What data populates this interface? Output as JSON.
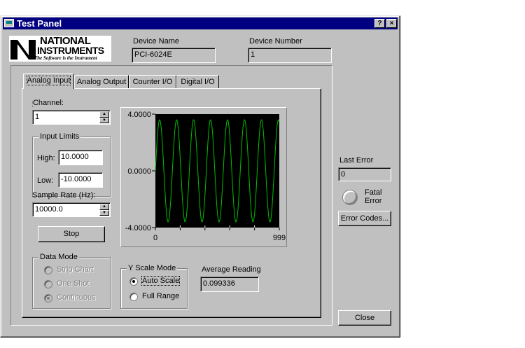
{
  "window": {
    "title": "Test Panel",
    "help_btn": "?",
    "close_btn": "×"
  },
  "logo": {
    "line1": "NATIONAL",
    "line2": "INSTRUMENTS",
    "tagline": "The Software is the Instrument"
  },
  "device": {
    "name_label": "Device Name",
    "name_value": "PCI-6024E",
    "number_label": "Device Number",
    "number_value": "1"
  },
  "tabs": [
    "Analog Input",
    "Analog Output",
    "Counter I/O",
    "Digital I/O"
  ],
  "analog_input": {
    "channel_label": "Channel:",
    "channel_value": "1",
    "input_limits_label": "Input Limits",
    "high_label": "High:",
    "high_value": "10.0000",
    "low_label": "Low:",
    "low_value": "-10.0000",
    "sample_rate_label": "Sample Rate (Hz):",
    "sample_rate_value": "10000.0",
    "stop_label": "Stop",
    "data_mode_label": "Data Mode",
    "data_modes": [
      "Strip Chart",
      "One Shot",
      "Continuous"
    ],
    "data_mode_selected": 2,
    "y_scale_label": "Y Scale Mode",
    "y_scale_modes": [
      "Auto Scale",
      "Full Range"
    ],
    "y_scale_selected": 0,
    "avg_label": "Average Reading",
    "avg_value": "0.099336"
  },
  "graph": {
    "y_ticks": [
      "4.0000",
      "0.0000",
      "-4.0000"
    ],
    "x_ticks": [
      "0",
      "999"
    ],
    "trace_color": "#00c000",
    "background": "#000000",
    "cycles": 7.3,
    "amplitude": 3.6,
    "y_range": [
      -4,
      4
    ],
    "x_range": [
      0,
      999
    ]
  },
  "error": {
    "last_error_label": "Last Error",
    "last_error_value": "0",
    "fatal_label_1": "Fatal",
    "fatal_label_2": "Error",
    "codes_button": "Error Codes..."
  },
  "close_label": "Close"
}
